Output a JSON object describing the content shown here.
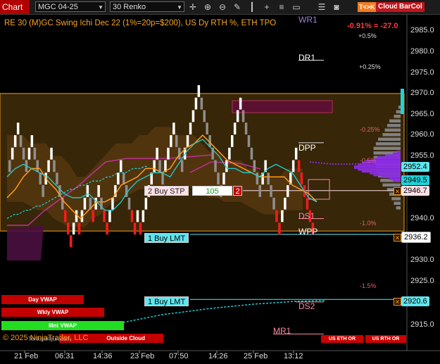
{
  "toolbar": {
    "chart_label": "Chart",
    "instrument": "MGC 04-25",
    "bar_type": "30 Renko",
    "icons": [
      "crosshair-icon",
      "zoom-in-icon",
      "zoom-out-icon",
      "drawing-tools-icon",
      "bar-props-icon",
      "plus-icon",
      "properties-icon",
      "chat-icon",
      "list-icon",
      "camera-icon"
    ],
    "tk_label": "T<>K",
    "cloud_label": "Cloud",
    "barcol_label": "BarCol",
    "tk_color": "#f47b20",
    "cloud_color": "#c0151c",
    "barcol_color": "#c0151c"
  },
  "chart": {
    "indicator_title": "RE 30 (M)GC Swing Ichi Dec 22 (1%=20p=$200), US Dy RTH %, ETH TPO",
    "pct_readout": "-0.91% = -27.0",
    "pct_levels": [
      "+0.5%",
      "+0.25%",
      "-0.25%",
      "-0.5%",
      "-1.0%",
      "-1.5%"
    ],
    "pivots": [
      "WR1",
      "DR1",
      "DPP",
      "DS1",
      "WPP",
      "DS2",
      "MR1"
    ],
    "order_labels": {
      "buy_stop": "2 Buy STP",
      "buy_stop_price": "105",
      "buy_stop_qty": "2",
      "buy_limit_1": "1 Buy LMT",
      "buy_limit_2": "1 Buy LMT"
    },
    "price_tags": [
      "2952.4",
      "2949.5",
      "2946.7",
      "2936.2",
      "2920.6"
    ],
    "vwap_labels": [
      "Day VWAP",
      "Wkly VWAP",
      "Mnt VWAP",
      "Outside Cloud"
    ],
    "copyright": "© 2025 NinjaTrader, LLC",
    "watermark": "TenkanKijun.com",
    "small_buttons": [
      "US ETH OR",
      "US RTH OR"
    ],
    "colors": {
      "bull_brick": "#ffffff",
      "bear_brick": "#8f8f8f",
      "bear_brick_red": "#ff1a1a",
      "tenkan": "#1fd2d8",
      "kijun": "#ff9a1a",
      "cloud_fill": "#5a3a10",
      "volume_profile": "#8a2be2",
      "tpo": "#808080",
      "range_border": "#f59a23"
    }
  },
  "chart_data": {
    "type": "renko",
    "instrument": "MGC 04-25",
    "brick_type": "30 Renko",
    "ylim": [
      2910,
      2988
    ],
    "y_ticks": [
      2915,
      2920,
      2925,
      2930,
      2935,
      2940,
      2945,
      2950,
      2955,
      2960,
      2965,
      2970,
      2975,
      2980,
      2985
    ],
    "x_ticks": [
      "21 Feb",
      "06:31",
      "14:36",
      "23 Feb",
      "07:50",
      "14:26",
      "25 Feb",
      "13:12"
    ],
    "bricks": [
      {
        "i": 0,
        "d": "down",
        "o": 2954,
        "c": 2951
      },
      {
        "i": 1,
        "d": "up",
        "o": 2954,
        "c": 2957
      },
      {
        "i": 2,
        "d": "up",
        "o": 2957,
        "c": 2960
      },
      {
        "i": 3,
        "d": "up",
        "o": 2960,
        "c": 2963
      },
      {
        "i": 4,
        "d": "down",
        "o": 2960,
        "c": 2957
      },
      {
        "i": 5,
        "d": "down",
        "o": 2957,
        "c": 2954
      },
      {
        "i": 6,
        "d": "down",
        "o": 2954,
        "c": 2951
      },
      {
        "i": 7,
        "d": "up",
        "o": 2954,
        "c": 2957
      },
      {
        "i": 8,
        "d": "up",
        "o": 2957,
        "c": 2960
      },
      {
        "i": 9,
        "d": "down",
        "o": 2957,
        "c": 2954
      },
      {
        "i": 10,
        "d": "down",
        "o": 2954,
        "c": 2951
      },
      {
        "i": 11,
        "d": "down",
        "o": 2951,
        "c": 2948
      },
      {
        "i": 12,
        "d": "down",
        "o": 2948,
        "c": 2945
      },
      {
        "i": 13,
        "d": "up",
        "o": 2948,
        "c": 2951
      },
      {
        "i": 14,
        "d": "up",
        "o": 2951,
        "c": 2954
      },
      {
        "i": 15,
        "d": "up",
        "o": 2954,
        "c": 2957
      },
      {
        "i": 16,
        "d": "down",
        "o": 2954,
        "c": 2951
      },
      {
        "i": 17,
        "d": "down",
        "o": 2951,
        "c": 2948
      },
      {
        "i": 18,
        "d": "down",
        "o": 2948,
        "c": 2945
      },
      {
        "i": 19,
        "d": "down",
        "o": 2945,
        "c": 2942
      },
      {
        "i": 20,
        "d": "down",
        "o": 2942,
        "c": 2939
      },
      {
        "i": 21,
        "d": "down",
        "o": 2939,
        "c": 2936
      },
      {
        "i": 22,
        "d": "down",
        "o": 2936,
        "c": 2933
      },
      {
        "i": 23,
        "d": "up",
        "o": 2936,
        "c": 2939
      },
      {
        "i": 24,
        "d": "up",
        "o": 2939,
        "c": 2942
      },
      {
        "i": 25,
        "d": "down",
        "o": 2939,
        "c": 2936
      },
      {
        "i": 26,
        "d": "up",
        "o": 2939,
        "c": 2942
      },
      {
        "i": 27,
        "d": "up",
        "o": 2942,
        "c": 2945
      },
      {
        "i": 28,
        "d": "up",
        "o": 2945,
        "c": 2948
      },
      {
        "i": 29,
        "d": "down",
        "o": 2945,
        "c": 2942
      },
      {
        "i": 30,
        "d": "down",
        "o": 2942,
        "c": 2939
      },
      {
        "i": 31,
        "d": "up",
        "o": 2942,
        "c": 2945
      },
      {
        "i": 32,
        "d": "up",
        "o": 2945,
        "c": 2948
      },
      {
        "i": 33,
        "d": "down",
        "o": 2945,
        "c": 2942
      },
      {
        "i": 34,
        "d": "down",
        "o": 2942,
        "c": 2939
      },
      {
        "i": 35,
        "d": "down",
        "o": 2939,
        "c": 2936
      },
      {
        "i": 36,
        "d": "up",
        "o": 2939,
        "c": 2942
      },
      {
        "i": 37,
        "d": "up",
        "o": 2942,
        "c": 2945
      },
      {
        "i": 38,
        "d": "up",
        "o": 2945,
        "c": 2948
      },
      {
        "i": 39,
        "d": "up",
        "o": 2948,
        "c": 2951
      },
      {
        "i": 40,
        "d": "up",
        "o": 2951,
        "c": 2954
      },
      {
        "i": 41,
        "d": "down",
        "o": 2951,
        "c": 2948
      },
      {
        "i": 42,
        "d": "down",
        "o": 2948,
        "c": 2945
      },
      {
        "i": 43,
        "d": "down",
        "o": 2945,
        "c": 2942
      },
      {
        "i": 44,
        "d": "down",
        "o": 2942,
        "c": 2939
      },
      {
        "i": 45,
        "d": "down",
        "o": 2939,
        "c": 2936
      },
      {
        "i": 46,
        "d": "up",
        "o": 2939,
        "c": 2942
      },
      {
        "i": 47,
        "d": "down",
        "o": 2939,
        "c": 2936
      },
      {
        "i": 48,
        "d": "up",
        "o": 2939,
        "c": 2942
      },
      {
        "i": 49,
        "d": "up",
        "o": 2942,
        "c": 2945
      },
      {
        "i": 50,
        "d": "up",
        "o": 2945,
        "c": 2948
      },
      {
        "i": 51,
        "d": "up",
        "o": 2948,
        "c": 2951
      },
      {
        "i": 52,
        "d": "up",
        "o": 2951,
        "c": 2954
      },
      {
        "i": 53,
        "d": "up",
        "o": 2954,
        "c": 2957
      },
      {
        "i": 54,
        "d": "down",
        "o": 2954,
        "c": 2951
      },
      {
        "i": 55,
        "d": "down",
        "o": 2951,
        "c": 2948
      },
      {
        "i": 56,
        "d": "up",
        "o": 2951,
        "c": 2954
      },
      {
        "i": 57,
        "d": "up",
        "o": 2954,
        "c": 2957
      },
      {
        "i": 58,
        "d": "up",
        "o": 2957,
        "c": 2960
      },
      {
        "i": 59,
        "d": "up",
        "o": 2960,
        "c": 2963
      },
      {
        "i": 60,
        "d": "down",
        "o": 2960,
        "c": 2957
      },
      {
        "i": 61,
        "d": "down",
        "o": 2957,
        "c": 2954
      },
      {
        "i": 62,
        "d": "down",
        "o": 2954,
        "c": 2951
      },
      {
        "i": 63,
        "d": "up",
        "o": 2954,
        "c": 2957
      },
      {
        "i": 64,
        "d": "up",
        "o": 2957,
        "c": 2960
      },
      {
        "i": 65,
        "d": "up",
        "o": 2960,
        "c": 2963
      },
      {
        "i": 66,
        "d": "up",
        "o": 2963,
        "c": 2966
      },
      {
        "i": 67,
        "d": "up",
        "o": 2966,
        "c": 2969
      },
      {
        "i": 68,
        "d": "up",
        "o": 2969,
        "c": 2972
      },
      {
        "i": 69,
        "d": "down",
        "o": 2969,
        "c": 2966
      },
      {
        "i": 70,
        "d": "down",
        "o": 2966,
        "c": 2963
      },
      {
        "i": 71,
        "d": "down",
        "o": 2963,
        "c": 2960
      },
      {
        "i": 72,
        "d": "down",
        "o": 2960,
        "c": 2957
      },
      {
        "i": 73,
        "d": "down",
        "o": 2957,
        "c": 2954
      },
      {
        "i": 74,
        "d": "down",
        "o": 2954,
        "c": 2951
      },
      {
        "i": 75,
        "d": "down",
        "o": 2951,
        "c": 2948
      },
      {
        "i": 76,
        "d": "down",
        "o": 2948,
        "c": 2945
      },
      {
        "i": 77,
        "d": "up",
        "o": 2948,
        "c": 2951
      },
      {
        "i": 78,
        "d": "up",
        "o": 2951,
        "c": 2954
      },
      {
        "i": 79,
        "d": "up",
        "o": 2954,
        "c": 2957
      },
      {
        "i": 80,
        "d": "up",
        "o": 2957,
        "c": 2960
      },
      {
        "i": 81,
        "d": "up",
        "o": 2960,
        "c": 2963
      },
      {
        "i": 82,
        "d": "up",
        "o": 2963,
        "c": 2966
      },
      {
        "i": 83,
        "d": "up",
        "o": 2966,
        "c": 2969
      },
      {
        "i": 84,
        "d": "down",
        "o": 2966,
        "c": 2963
      },
      {
        "i": 85,
        "d": "down",
        "o": 2963,
        "c": 2960
      },
      {
        "i": 86,
        "d": "down",
        "o": 2960,
        "c": 2957
      },
      {
        "i": 87,
        "d": "down",
        "o": 2957,
        "c": 2954
      },
      {
        "i": 88,
        "d": "down",
        "o": 2954,
        "c": 2951
      },
      {
        "i": 89,
        "d": "down",
        "o": 2951,
        "c": 2948
      },
      {
        "i": 90,
        "d": "down",
        "o": 2948,
        "c": 2945
      },
      {
        "i": 91,
        "d": "up",
        "o": 2948,
        "c": 2951
      },
      {
        "i": 92,
        "d": "up",
        "o": 2951,
        "c": 2954
      },
      {
        "i": 93,
        "d": "down",
        "o": 2951,
        "c": 2948
      },
      {
        "i": 94,
        "d": "down",
        "o": 2948,
        "c": 2945
      },
      {
        "i": 95,
        "d": "down",
        "o": 2945,
        "c": 2942
      },
      {
        "i": 96,
        "d": "down",
        "o": 2942,
        "c": 2939
      },
      {
        "i": 97,
        "d": "down",
        "o": 2939,
        "c": 2936
      },
      {
        "i": 98,
        "d": "up",
        "o": 2939,
        "c": 2942
      },
      {
        "i": 99,
        "d": "up",
        "o": 2942,
        "c": 2945
      },
      {
        "i": 100,
        "d": "up",
        "o": 2945,
        "c": 2948
      },
      {
        "i": 101,
        "d": "up",
        "o": 2948,
        "c": 2951
      },
      {
        "i": 102,
        "d": "up",
        "o": 2951,
        "c": 2954
      },
      {
        "i": 103,
        "d": "up",
        "o": 2954,
        "c": 2957
      },
      {
        "i": 104,
        "d": "down",
        "o": 2954,
        "c": 2951
      },
      {
        "i": 105,
        "d": "down",
        "o": 2951,
        "c": 2948
      },
      {
        "i": 106,
        "d": "down",
        "o": 2948,
        "c": 2945
      },
      {
        "i": 107,
        "d": "down",
        "o": 2945,
        "c": 2942
      },
      {
        "i": 108,
        "d": "down",
        "o": 2942,
        "c": 2939
      },
      {
        "i": 109,
        "d": "down",
        "o": 2939,
        "c": 2936
      }
    ],
    "tenkan": [
      2950,
      2952,
      2953,
      2952,
      2951,
      2950,
      2948,
      2946,
      2945,
      2945,
      2946,
      2944,
      2942,
      2942,
      2944,
      2947,
      2949,
      2950,
      2951,
      2951,
      2950,
      2953,
      2956,
      2958,
      2959,
      2957,
      2955,
      2952,
      2952,
      2951,
      2951,
      2950,
      2952,
      2953,
      2952,
      2951,
      2948,
      2945,
      2944
    ],
    "kijun": [
      2945,
      2947,
      2950,
      2952,
      2952,
      2949,
      2947,
      2944,
      2942,
      2940,
      2942,
      2944,
      2944,
      2945,
      2948,
      2949,
      2950,
      2952,
      2952,
      2951,
      2952,
      2955,
      2957,
      2958,
      2960,
      2958,
      2956,
      2954,
      2953,
      2952,
      2951,
      2950,
      2950,
      2950,
      2950,
      2948,
      2947,
      2946,
      2944
    ],
    "cloud_top": [
      2960,
      2960,
      2960,
      2958,
      2958,
      2958,
      2955,
      2955,
      2953,
      2950,
      2950,
      2952,
      2954,
      2956,
      2958,
      2958,
      2958,
      2960,
      2960,
      2962,
      2962,
      2962,
      2960,
      2960,
      2960,
      2958,
      2956,
      2956,
      2954,
      2954,
      2954,
      2952,
      2952,
      2950,
      2950,
      2950,
      2952,
      2952,
      2952
    ],
    "cloud_bottom": [
      2944,
      2944,
      2944,
      2943,
      2942,
      2942,
      2940,
      2939,
      2938,
      2938,
      2938,
      2940,
      2941,
      2943,
      2944,
      2945,
      2946,
      2947,
      2947,
      2948,
      2948,
      2948,
      2948,
      2948,
      2947,
      2946,
      2945,
      2945,
      2944,
      2944,
      2944,
      2943,
      2942,
      2941,
      2941,
      2941,
      2942,
      2942,
      2942
    ],
    "vwap": [
      2940,
      2940.5,
      2941,
      2941,
      2941.5,
      2942,
      2942,
      2942.5,
      2943,
      2943,
      2943.5,
      2944,
      2944.5,
      2945,
      2945.5,
      2946,
      2946.5,
      2947,
      2947,
      2947.5,
      2948,
      2948,
      2948.5,
      2949,
      2949,
      2949,
      2949.5,
      2950,
      2950,
      2950.5,
      2951,
      2951,
      2951,
      2951.5,
      2952,
      2952,
      2952,
      2952.5,
      2952.5
    ],
    "range_box": {
      "top": 2970,
      "bottom": 2937
    },
    "levels": {
      "wr1": 2987,
      "dr1": 2978,
      "dpp": 2957,
      "ds1": 2942,
      "wpp": 2936,
      "ds2": 2921,
      "mr1": 2914
    },
    "pct_level_prices": [
      2985,
      2973,
      2959,
      2953,
      2939,
      2923
    ],
    "order_levels": {
      "buy_stop": 2946.7,
      "buy_limit_1": 2936.2,
      "buy_limit_2": 2920.6
    },
    "volume_profile": [
      1,
      2,
      4,
      6,
      7,
      9,
      10,
      11,
      12,
      12,
      11,
      10,
      8,
      7,
      5,
      3,
      2
    ],
    "tpo": [
      1,
      2,
      3,
      5,
      6,
      7,
      8,
      10,
      11,
      12,
      12,
      12,
      12,
      11,
      11,
      10,
      9,
      8,
      6,
      5,
      4,
      3,
      2
    ]
  }
}
